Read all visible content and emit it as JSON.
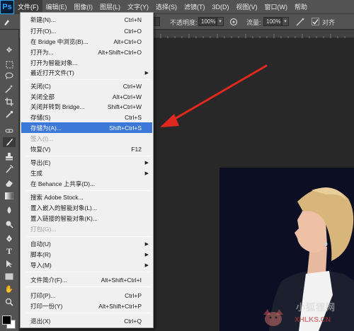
{
  "app": {
    "logo": "Ps"
  },
  "menubar": [
    {
      "label": "文件(F)"
    },
    {
      "label": "编辑(E)"
    },
    {
      "label": "图像(I)"
    },
    {
      "label": "图层(L)"
    },
    {
      "label": "文字(Y)"
    },
    {
      "label": "选择(S)"
    },
    {
      "label": "滤镜(T)"
    },
    {
      "label": "3D(D)"
    },
    {
      "label": "视图(V)"
    },
    {
      "label": "窗口(W)"
    },
    {
      "label": "帮助"
    }
  ],
  "options": {
    "mode_value": "",
    "opacity_label": "不透明度:",
    "opacity_value": "100%",
    "flow_label": "流量:",
    "flow_value": "100%",
    "align_label": "对齐"
  },
  "file_menu": [
    {
      "label": "新建(N)...",
      "shortcut": "Ctrl+N"
    },
    {
      "label": "打开(O)...",
      "shortcut": "Ctrl+O"
    },
    {
      "label": "在 Bridge 中浏览(B)...",
      "shortcut": "Alt+Ctrl+O"
    },
    {
      "label": "打开为...",
      "shortcut": "Alt+Shift+Ctrl+O"
    },
    {
      "label": "打开为智能对象...",
      "shortcut": ""
    },
    {
      "label": "最近打开文件(T)",
      "shortcut": "",
      "submenu": true
    },
    {
      "label": "关闭(C)",
      "shortcut": "Ctrl+W"
    },
    {
      "label": "关闭全部",
      "shortcut": "Alt+Ctrl+W"
    },
    {
      "label": "关闭并转到 Bridge...",
      "shortcut": "Shift+Ctrl+W"
    },
    {
      "label": "存储(S)",
      "shortcut": "Ctrl+S"
    },
    {
      "label": "存储为(A)...",
      "shortcut": "Shift+Ctrl+S",
      "highlighted": true
    },
    {
      "label": "签入(I)...",
      "shortcut": "",
      "disabled": true
    },
    {
      "label": "恢复(V)",
      "shortcut": "F12"
    },
    {
      "label": "导出(E)",
      "shortcut": "",
      "submenu": true
    },
    {
      "label": "生成",
      "shortcut": "",
      "submenu": true
    },
    {
      "label": "在 Behance 上共享(D)...",
      "shortcut": ""
    },
    {
      "label": "搜索 Adobe Stock...",
      "shortcut": ""
    },
    {
      "label": "置入嵌入的智能对象(L)...",
      "shortcut": ""
    },
    {
      "label": "置入链接的智能对象(K)...",
      "shortcut": ""
    },
    {
      "label": "打包(G)...",
      "shortcut": "",
      "disabled": true
    },
    {
      "label": "自动(U)",
      "shortcut": "",
      "submenu": true
    },
    {
      "label": "脚本(R)",
      "shortcut": "",
      "submenu": true
    },
    {
      "label": "导入(M)",
      "shortcut": "",
      "submenu": true
    },
    {
      "label": "文件简介(F)...",
      "shortcut": "Alt+Shift+Ctrl+I"
    },
    {
      "label": "打印(P)...",
      "shortcut": "Ctrl+P"
    },
    {
      "label": "打印一份(Y)",
      "shortcut": "Alt+Shift+Ctrl+P"
    },
    {
      "label": "退出(X)",
      "shortcut": "Ctrl+Q"
    }
  ],
  "tools": [
    "move-icon",
    "marquee-icon",
    "lasso-icon",
    "magic-wand-icon",
    "crop-icon",
    "eyedropper-icon",
    "healing-brush-icon",
    "brush-icon",
    "clone-stamp-icon",
    "history-brush-icon",
    "eraser-icon",
    "gradient-icon",
    "blur-icon",
    "dodge-icon",
    "pen-icon",
    "type-icon",
    "path-selection-icon",
    "rectangle-icon",
    "hand-icon",
    "zoom-icon"
  ],
  "colors": {
    "menu_highlight": "#3b78d8",
    "arrow": "#e0281e",
    "chrome": "#535353"
  },
  "watermark": {
    "main": "小狐狸网",
    "sub": "XHLKS.CN"
  }
}
